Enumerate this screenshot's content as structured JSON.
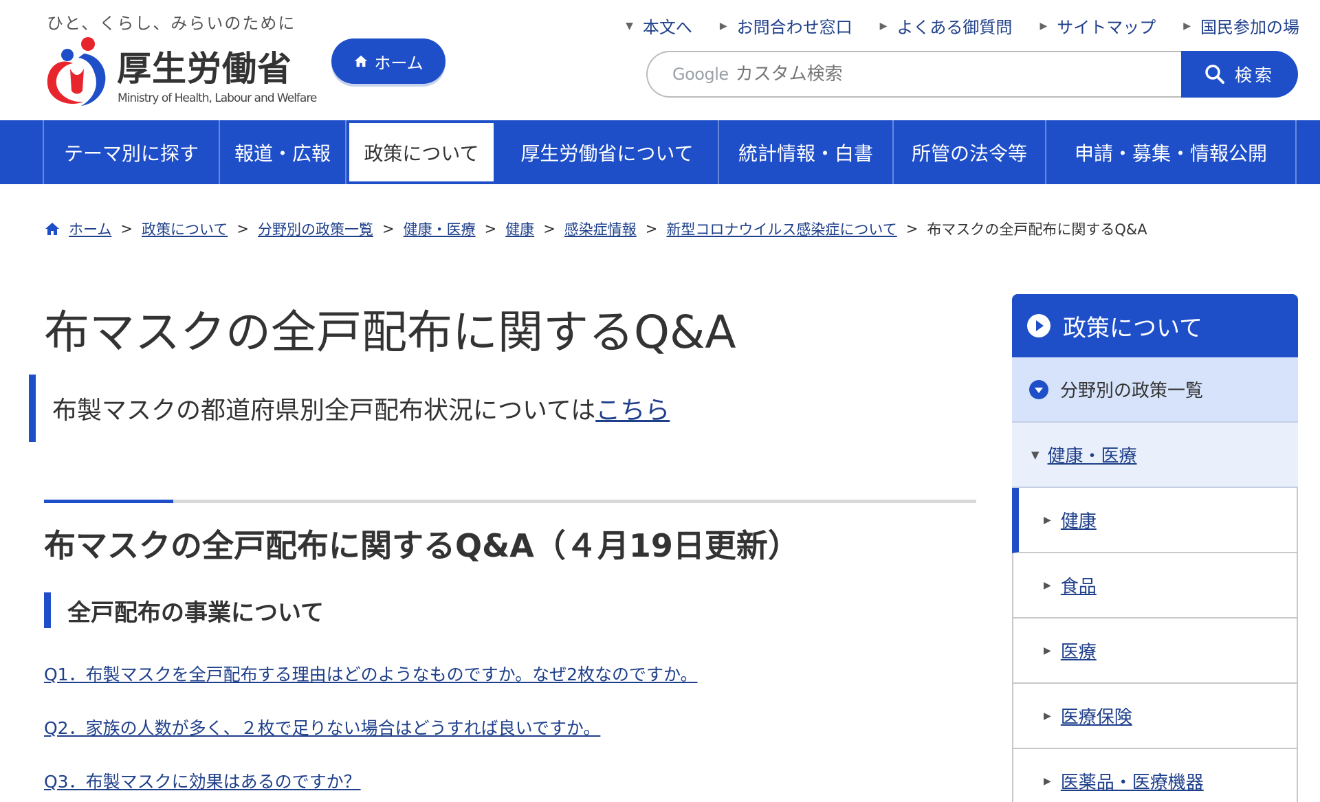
{
  "header": {
    "tagline": "ひと、くらし、みらいのために",
    "logo_jp": "厚生労働省",
    "logo_en": "Ministry of Health, Labour and Welfare",
    "home_label": "ホーム",
    "util_nav": [
      "本文へ",
      "お問合わせ窓口",
      "よくある御質問",
      "サイトマップ",
      "国民参加の場"
    ],
    "search_brand": "Google",
    "search_placeholder": "カスタム検索",
    "search_button": "検索",
    "brand_color": "#1e4fc8"
  },
  "global_nav": [
    "テーマ別に探す",
    "報道・広報",
    "政策について",
    "厚生労働省について",
    "統計情報・白書",
    "所管の法令等",
    "申請・募集・情報公開"
  ],
  "global_nav_active": "政策について",
  "breadcrumb": {
    "links": [
      "ホーム",
      "政策について",
      "分野別の政策一覧",
      "健康・医療",
      "健康",
      "感染症情報",
      "新型コロナウイルス感染症について"
    ],
    "separator": ">",
    "current": "布マスクの全戸配布に関するQ&A"
  },
  "main": {
    "title": "布マスクの全戸配布に関するQ&A",
    "notice_text": "布製マスクの都道府県別全戸配布状況については",
    "notice_link": "こちら",
    "h2": "布マスクの全戸配布に関するQ&A（４月19日更新）",
    "h3": "全戸配布の事業について",
    "questions": [
      "Q1．布製マスクを全戸配布する理由はどのようなものですか。なぜ2枚なのですか。",
      "Q2．家族の人数が多く、２枚で足りない場合はどうすれば良いですか。",
      "Q3．布製マスクに効果はあるのですか？"
    ]
  },
  "sidebar": {
    "heading": "政策について",
    "sub_heading": "分野別の政策一覧",
    "category": "健康・医療",
    "items": [
      "健康",
      "食品",
      "医療",
      "医療保険",
      "医薬品・医療機器"
    ],
    "current_item": "健康"
  }
}
